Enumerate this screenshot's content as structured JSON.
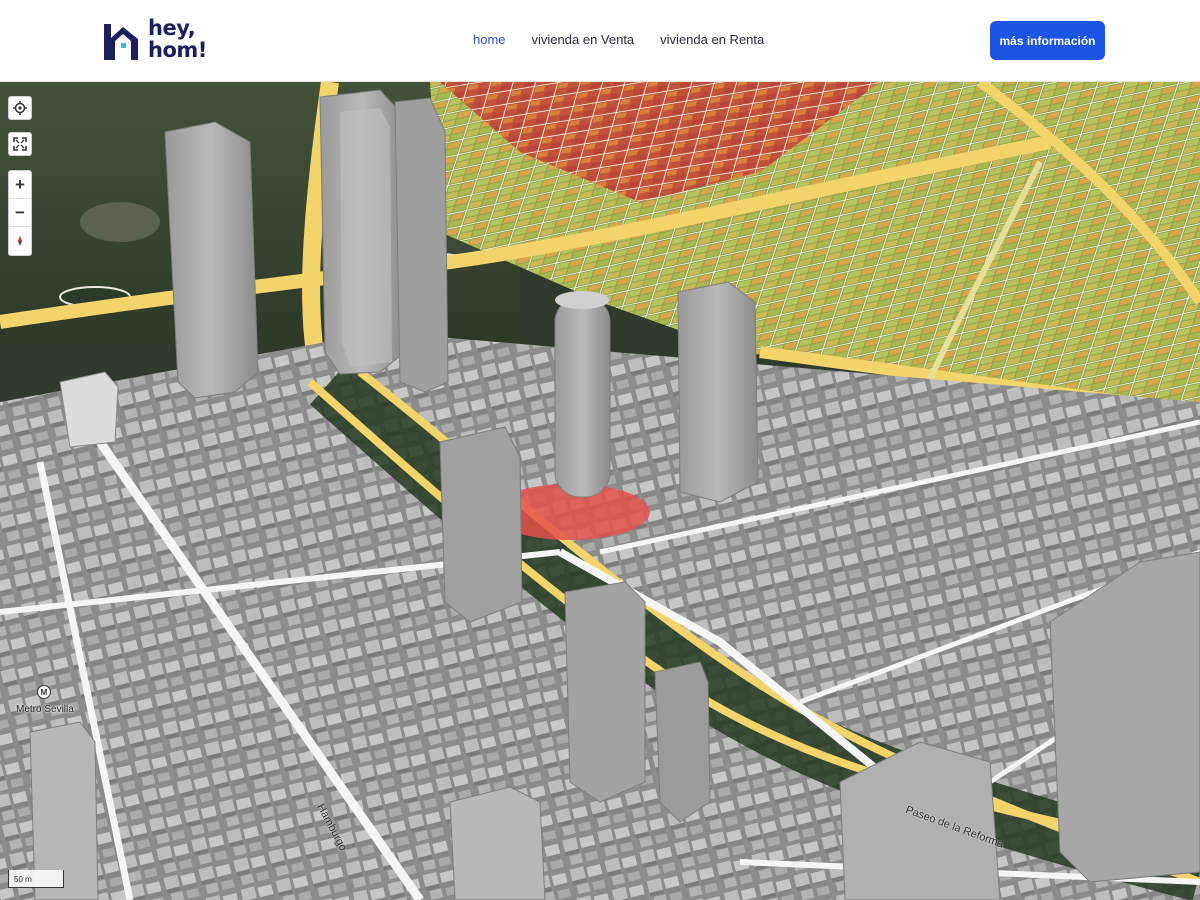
{
  "header": {
    "logo_line1": "hey,",
    "logo_line2": "hom!",
    "nav": [
      "home",
      "vivienda en Venta",
      "vivienda en Renta"
    ],
    "cta_label": "más información"
  },
  "map": {
    "scale_label": "50 m",
    "labels": {
      "metro": "Metro Sevilla",
      "street_1": "Hamburgo",
      "street_2": "Paseo de la Reforma"
    },
    "controls": {
      "zoom_in": "+",
      "zoom_out": "−"
    }
  },
  "colors": {
    "brand_navy": "#1c1f5c",
    "accent_blue": "#1c55e3",
    "nav_active": "#2a4bd7",
    "building_gray": "#a6a6a6",
    "road_yellow": "#f3d46a"
  },
  "icons": {
    "locate": "crosshair-icon",
    "fullscreen": "fullscreen-icon",
    "compass": "compass-icon"
  }
}
